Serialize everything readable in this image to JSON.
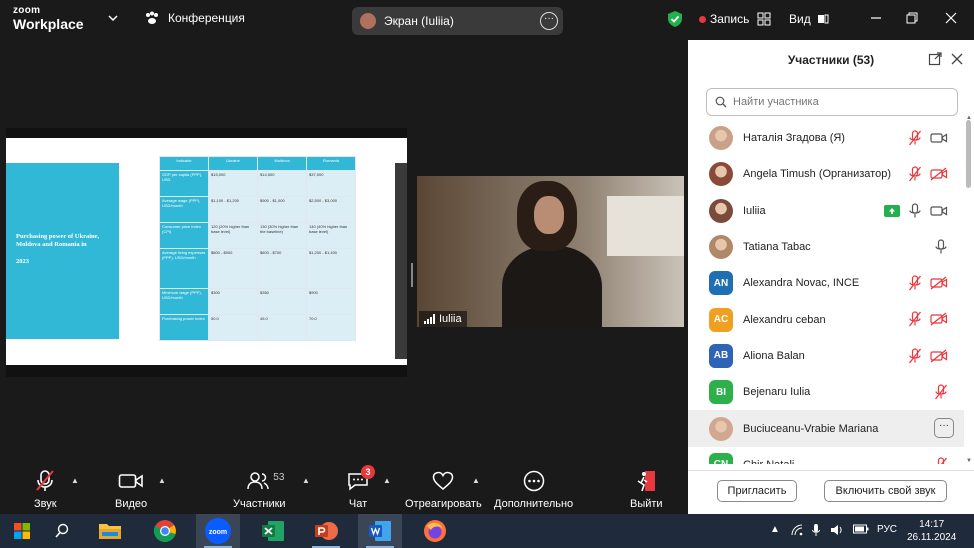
{
  "app": {
    "logo_line1": "zoom",
    "logo_line2": "Workplace",
    "meeting_label": "Конференция",
    "screen_share_label": "Экран (Iuliia)",
    "record_label": "Запись",
    "view_label": "Вид",
    "accent_color": "#0b5cff",
    "record_color": "#e8383d",
    "shield_color": "#23b14d"
  },
  "slide": {
    "title": "Purchasing power of Ukraine, Moldova and Romania in",
    "year": "2023",
    "headers": [
      "Indicator",
      "Ukraine",
      "Moldova",
      "Romania"
    ],
    "rows": [
      [
        "GDP per capita (PPP), USD",
        "$15,000",
        "$14,500",
        "$37,000"
      ],
      [
        "Average wage (PPP), USD/month",
        "$1,100 - $1,200",
        "$900 - $1,000",
        "$2,500 - $3,000"
      ],
      [
        "Consumer price index (CPI)",
        "120 (20% higher than base level)",
        "130 (30% higher than the baseline)",
        "140 (40% higher than base level)"
      ],
      [
        "Average living expenses (PPP), USD/month",
        "$800 - $900",
        "$600 - $700",
        "$1,200 - $1,400"
      ],
      [
        "Minimum wage (PPP), USD/month",
        "$300",
        "$350",
        "$900"
      ],
      [
        "Purchasing power index",
        "50.0",
        "45.0",
        "70.0"
      ]
    ]
  },
  "video": {
    "participant_name": "Iuliia"
  },
  "participants_panel": {
    "title": "Участники (53)",
    "search_placeholder": "Найти участника",
    "invite_label": "Пригласить",
    "unmute_label": "Включить свой звук",
    "items": [
      {
        "name": "Наталія Згадова (Я)",
        "avatar": "photo",
        "initials": "",
        "color": "#c9a088",
        "mic": "muted",
        "cam": "on"
      },
      {
        "name": "Angela Timush (Организатор)",
        "avatar": "photo",
        "initials": "",
        "color": "#8a4a3a",
        "mic": "muted",
        "cam": "off"
      },
      {
        "name": "Iuliia",
        "avatar": "photo",
        "initials": "",
        "color": "#7a4a3a",
        "mic": "on",
        "cam": "on",
        "sharing": true
      },
      {
        "name": "Tatiana Tabac",
        "avatar": "photo",
        "initials": "",
        "color": "#b08868",
        "mic": "on",
        "cam": "none"
      },
      {
        "name": "Alexandra Novac, INCE",
        "avatar": "initials",
        "initials": "AN",
        "color": "#1f6fb3",
        "mic": "muted",
        "cam": "off"
      },
      {
        "name": "Alexandru ceban",
        "avatar": "initials",
        "initials": "AC",
        "color": "#f0a020",
        "mic": "muted",
        "cam": "off"
      },
      {
        "name": "Aliona Balan",
        "avatar": "initials",
        "initials": "AB",
        "color": "#2f63b5",
        "mic": "muted",
        "cam": "off"
      },
      {
        "name": "Bejenaru Iulia",
        "avatar": "initials",
        "initials": "BI",
        "color": "#2bb04a",
        "mic": "muted",
        "cam": "none"
      },
      {
        "name": "Buciuceanu-Vrabie Mariana",
        "avatar": "photo",
        "initials": "",
        "color": "#d0a890",
        "mic": "none",
        "cam": "none",
        "highlighted": true
      },
      {
        "name": "Chir Natali",
        "avatar": "initials",
        "initials": "CN",
        "color": "#2bb04a",
        "mic": "muted",
        "cam": "none"
      }
    ]
  },
  "toolbar": {
    "audio_label": "Звук",
    "video_label": "Видео",
    "participants_label": "Участники",
    "participants_count": "53",
    "chat_label": "Чат",
    "chat_badge": "3",
    "react_label": "Отреагировать",
    "more_label": "Дополнительно",
    "leave_label": "Выйти"
  },
  "taskbar": {
    "lang": "РУС",
    "time": "14:17",
    "date": "26.11.2024",
    "zoom_app_label": "zoom"
  }
}
